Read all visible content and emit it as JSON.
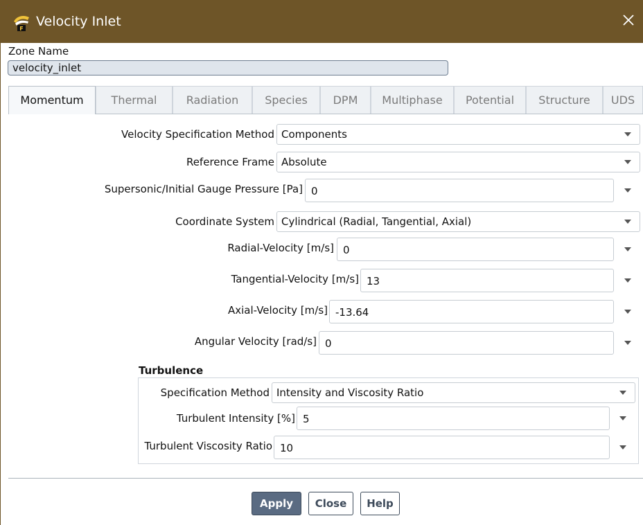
{
  "window": {
    "title": "Velocity Inlet"
  },
  "zone": {
    "label": "Zone Name",
    "value": "velocity_inlet"
  },
  "tabs": [
    {
      "label": "Momentum",
      "active": true
    },
    {
      "label": "Thermal"
    },
    {
      "label": "Radiation"
    },
    {
      "label": "Species"
    },
    {
      "label": "DPM"
    },
    {
      "label": "Multiphase"
    },
    {
      "label": "Potential"
    },
    {
      "label": "Structure"
    },
    {
      "label": "UDS"
    }
  ],
  "momentum": {
    "velocity_method": {
      "label": "Velocity Specification Method",
      "value": "Components"
    },
    "reference_frame": {
      "label": "Reference Frame",
      "value": "Absolute"
    },
    "gauge_pressure": {
      "label": "Supersonic/Initial Gauge Pressure [Pa]",
      "value": "0"
    },
    "coordinate_system": {
      "label": "Coordinate System",
      "value": "Cylindrical (Radial, Tangential, Axial)"
    },
    "radial_velocity": {
      "label": "Radial-Velocity [m/s]",
      "value": "0"
    },
    "tangential_velocity": {
      "label": "Tangential-Velocity [m/s]",
      "value": "13"
    },
    "axial_velocity": {
      "label": "Axial-Velocity [m/s]",
      "value": "-13.64"
    },
    "angular_velocity": {
      "label": "Angular Velocity [rad/s]",
      "value": "0"
    }
  },
  "turbulence": {
    "title": "Turbulence",
    "spec_method": {
      "label": "Specification Method",
      "value": "Intensity and Viscosity Ratio"
    },
    "intensity": {
      "label": "Turbulent Intensity [%]",
      "value": "5"
    },
    "viscosity_ratio": {
      "label": "Turbulent Viscosity Ratio",
      "value": "10"
    }
  },
  "buttons": {
    "apply": "Apply",
    "close": "Close",
    "help": "Help"
  },
  "colors": {
    "titlebar": "#6e5528",
    "primary_button": "#5a6b82"
  }
}
